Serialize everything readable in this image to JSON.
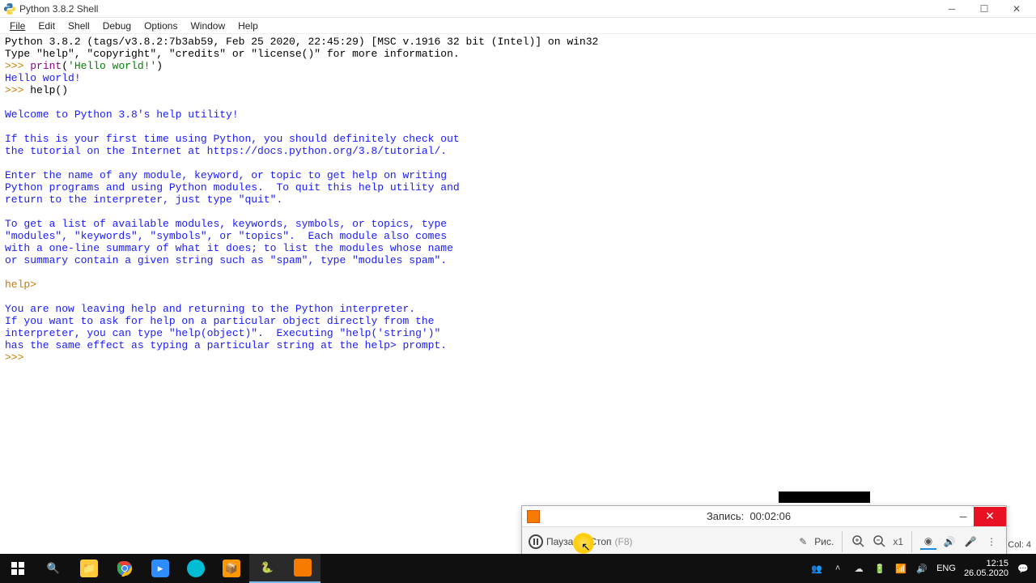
{
  "window": {
    "title": "Python 3.8.2 Shell"
  },
  "menu": {
    "file": "File",
    "edit": "Edit",
    "shell": "Shell",
    "debug": "Debug",
    "options": "Options",
    "window": "Window",
    "help": "Help"
  },
  "shell": {
    "banner1": "Python 3.8.2 (tags/v3.8.2:7b3ab59, Feb 25 2020, 22:45:29) [MSC v.1916 32 bit (Intel)] on win32",
    "banner2": "Type \"help\", \"copyright\", \"credits\" or \"license()\" for more information.",
    "prompt": ">>> ",
    "print_fn": "print",
    "print_open": "(",
    "print_arg": "'Hello world!'",
    "print_close": ")",
    "hw_out": "Hello world!",
    "help_call": "help()",
    "help_welcome": "Welcome to Python 3.8's help utility!",
    "p1a": "If this is your first time using Python, you should definitely check out",
    "p1b": "the tutorial on the Internet at https://docs.python.org/3.8/tutorial/.",
    "p2a": "Enter the name of any module, keyword, or topic to get help on writing",
    "p2b": "Python programs and using Python modules.  To quit this help utility and",
    "p2c": "return to the interpreter, just type \"quit\".",
    "p3a": "To get a list of available modules, keywords, symbols, or topics, type",
    "p3b": "\"modules\", \"keywords\", \"symbols\", or \"topics\".  Each module also comes",
    "p3c": "with a one-line summary of what it does; to list the modules whose name",
    "p3d": "or summary contain a given string such as \"spam\", type \"modules spam\".",
    "help_prompt": "help> ",
    "p4a": "You are now leaving help and returning to the Python interpreter.",
    "p4b": "If you want to ask for help on a particular object directly from the",
    "p4c": "interpreter, you can type \"help(object)\".  Executing \"help('string')\"",
    "p4d": "has the same effect as typing a particular string at the help> prompt."
  },
  "status": {
    "col": "Col: 4"
  },
  "recorder": {
    "title_prefix": "Запись:",
    "time": "00:02:06",
    "pause": "Пауза",
    "stop": "Стоп",
    "stop_key": "(F8)",
    "draw": "Рис.",
    "zoom": "x1"
  },
  "tray": {
    "lang": "ENG",
    "time": "12:15",
    "date": "26.05.2020"
  }
}
